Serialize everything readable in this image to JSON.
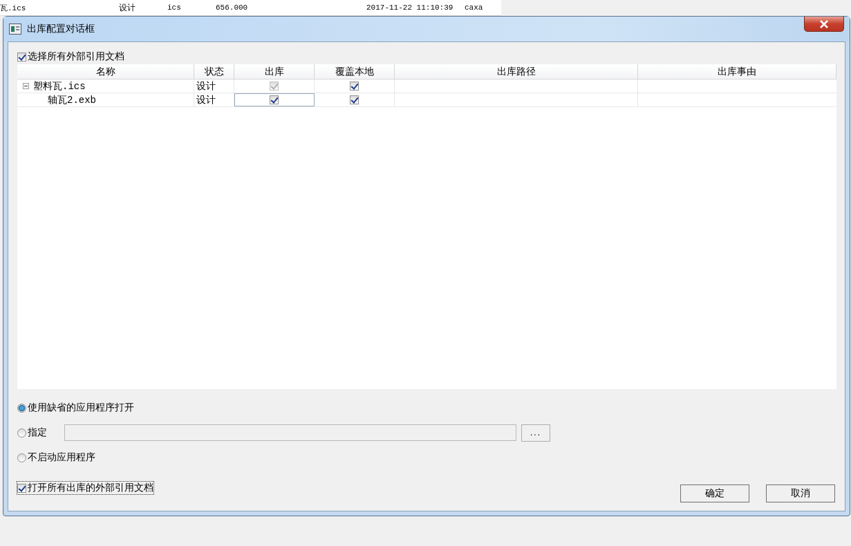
{
  "background_row": {
    "cells": [
      "瓦.ics",
      "设计",
      "ics",
      "656.000",
      "2017-11-22 11:10:39",
      "caxa"
    ]
  },
  "dialog": {
    "title": "出库配置对话框",
    "select_all": {
      "label": "选择所有外部引用文档",
      "checked": true
    },
    "table": {
      "columns": [
        "名称",
        "状态",
        "出库",
        "覆盖本地",
        "出库路径",
        "出库事由"
      ],
      "rows": [
        {
          "name": "塑料瓦.ics",
          "status": "设计",
          "checkout": true,
          "checkout_disabled": true,
          "overwrite": true,
          "expanded": true,
          "focused": false,
          "children": [
            {
              "name": "轴瓦2.exb",
              "status": "设计",
              "checkout": true,
              "checkout_disabled": false,
              "overwrite": true,
              "focused": true
            }
          ]
        }
      ]
    },
    "open_options": [
      {
        "label": "使用缺省的应用程序打开",
        "selected": true,
        "kind": "radio"
      },
      {
        "label": "指定",
        "selected": false,
        "kind": "radio-with-path"
      },
      {
        "label": "不启动应用程序",
        "selected": false,
        "kind": "radio"
      }
    ],
    "browse_button": "...",
    "open_all": {
      "label": "打开所有出库的外部引用文档",
      "checked": true
    },
    "buttons": [
      "确定",
      "取消"
    ]
  }
}
